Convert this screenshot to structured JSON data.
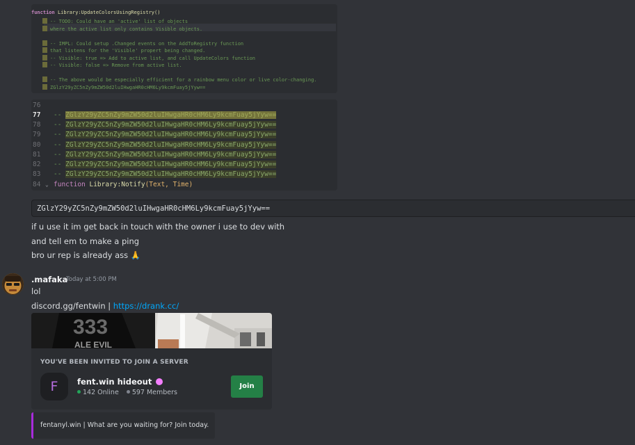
{
  "code_snippet_1": {
    "function_keyword": "function",
    "function_name": "Library:UpdateColorsUsingRegistry()",
    "lines": [
      "-- TODO: Could have an 'active' list of objects",
      "where the active list only contains Visible objects.",
      "",
      "-- IMPL: Could setup .Changed events on the AddToRegistry function",
      "that listens for the 'Visible' propert being changed.",
      "-- Visible: true => Add to active list, and call UpdateColors function",
      "-- Visible: false => Remove from active list.",
      "",
      "-- The above would be especially efficient for a rainbow menu color or live color-changing.",
      "ZGlzY29yZC5nZy9mZW50d2luIHwgaHR0cHM6Ly9kcmFuay5jYyw=="
    ]
  },
  "code_snippet_2": {
    "line_numbers": [
      "76",
      "77",
      "78",
      "79",
      "80",
      "81",
      "82",
      "83",
      "84"
    ],
    "comment_prefix": "-- ",
    "encoded_text": "ZGlzY29yZC5nZy9mZW50d2luIHwgaHR0cHM6Ly9kcmFuay5jYyw==",
    "last_line": {
      "keyword": "function ",
      "name": "Library:Notify",
      "args": "(Text, Time)"
    }
  },
  "code_block_text": "ZGlzY29yZC5nZy9mZW50d2luIHwgaHR0cHM6Ly9kcmFuay5jYyw==",
  "messages_prev": [
    "if u use it im get back in touch with the owner i use to dev with",
    "and tell em to make a ping",
    "bro ur rep is already ass"
  ],
  "emoji_pray": "🙏",
  "author": {
    "username": ".mafaka",
    "timestamp": "Today at 5:00 PM"
  },
  "messages": {
    "lol": "lol",
    "invite_prefix": "discord.gg/fentwin | ",
    "link": "https://drank.cc/"
  },
  "invite": {
    "heading": "YOU'VE BEEN INVITED TO JOIN A SERVER",
    "server_icon_letter": "F",
    "server_name": "fent.win hideout",
    "online": "142 Online",
    "members": "597 Members",
    "join_label": "Join"
  },
  "embed": {
    "text": "fentanyl.win | What are you waiting for? Join today."
  },
  "colors": {
    "background": "#313338",
    "link": "#00a8fc",
    "join_button": "#248046",
    "embed_accent": "#a82bdc",
    "online_dot": "#23a55a",
    "members_dot": "#80848e"
  }
}
